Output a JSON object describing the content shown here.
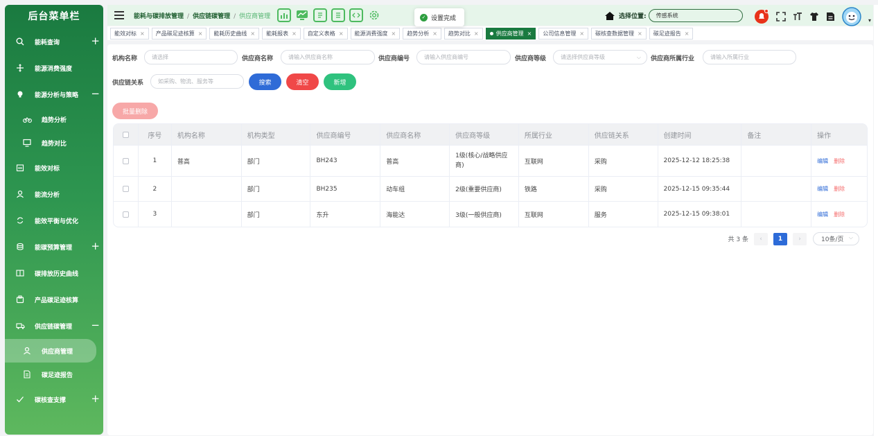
{
  "sidebar": {
    "title": "后台菜单栏",
    "items": [
      {
        "label": "能耗查询",
        "icon": "search-icon",
        "expander": "+"
      },
      {
        "label": "能源消费强度",
        "icon": "move-icon",
        "expander": ""
      },
      {
        "label": "能源分析与策略",
        "icon": "bulb-icon",
        "expander": "−"
      },
      {
        "label": "趋势分析",
        "icon": "bicycle-icon",
        "sub": true
      },
      {
        "label": "趋势对比",
        "icon": "monitor-icon",
        "sub": true
      },
      {
        "label": "能效对标",
        "icon": "calendar-icon",
        "expander": ""
      },
      {
        "label": "能流分析",
        "icon": "user-icon",
        "expander": ""
      },
      {
        "label": "能效平衡与优化",
        "icon": "refresh-icon",
        "expander": ""
      },
      {
        "label": "能碳预算管理",
        "icon": "coins-icon",
        "expander": "+"
      },
      {
        "label": "碳排放历史曲线",
        "icon": "book-icon",
        "expander": ""
      },
      {
        "label": "产品碳足迹核算",
        "icon": "box-icon",
        "expander": ""
      },
      {
        "label": "供应链碳管理",
        "icon": "truck-icon",
        "expander": "−"
      },
      {
        "label": "供应商管理",
        "icon": "user-icon",
        "sub": true,
        "active": true
      },
      {
        "label": "碳足迹报告",
        "icon": "document-icon",
        "sub": true
      },
      {
        "label": "碳核查支撑",
        "icon": "check-icon",
        "expander": "+"
      }
    ]
  },
  "breadcrumb": {
    "level1": "能耗与碳排放管理",
    "sep": "/",
    "level2": "供应链碳管理",
    "level3": "供应商管理"
  },
  "toast": {
    "icon": "check-icon",
    "text": "设置完成"
  },
  "location": {
    "label": "选择位置:",
    "value": "传感系统"
  },
  "tabs": [
    {
      "label": "能效对标",
      "close": "×"
    },
    {
      "label": "产品碳足迹核算",
      "close": "×"
    },
    {
      "label": "能耗历史曲线",
      "close": "×"
    },
    {
      "label": "能耗报表",
      "close": "×"
    },
    {
      "label": "自定义表格",
      "close": "×"
    },
    {
      "label": "能源消费强度",
      "close": "×"
    },
    {
      "label": "趋势分析",
      "close": "×"
    },
    {
      "label": "趋势对比",
      "close": "×"
    },
    {
      "label": "供应商管理",
      "close": "×",
      "active": true
    },
    {
      "label": "公司信息管理",
      "close": "×"
    },
    {
      "label": "碳核查数据管理",
      "close": "×"
    },
    {
      "label": "碳足迹报告",
      "close": "×"
    }
  ],
  "filters": {
    "org_name": {
      "label": "机构名称",
      "placeholder": "请选择"
    },
    "supplier_name": {
      "label": "供应商名称",
      "placeholder": "请输入供应商名称"
    },
    "supplier_code": {
      "label": "供应商编号",
      "placeholder": "请输入供应商编号"
    },
    "supplier_level": {
      "label": "供应商等级",
      "placeholder": "请选择供应商等级"
    },
    "industry": {
      "label": "供应商所属行业",
      "placeholder": "请输入所属行业"
    },
    "chain_relation": {
      "label": "供应链关系",
      "placeholder": "如采购、物流、服务等"
    }
  },
  "buttons": {
    "search": "搜索",
    "clear": "清空",
    "add": "新增",
    "batch_delete": "批量删除"
  },
  "colors": {
    "primary_green": "#1a7a40",
    "search_blue": "#2f6bd7",
    "clear_red": "#f04848",
    "add_green": "#2fc27e",
    "batch_pink": "#f7a8a8"
  },
  "table": {
    "headers": [
      "序号",
      "机构名称",
      "机构类型",
      "供应商编号",
      "供应商名称",
      "供应商等级",
      "所属行业",
      "供应链关系",
      "创建时间",
      "备注",
      "操作"
    ],
    "rows": [
      {
        "no": "1",
        "org": "普高",
        "type": "部门",
        "code": "BH243",
        "name": "普高",
        "level": "1级(核心/战略供应商)",
        "industry": "互联网",
        "relation": "采购",
        "created": "2025-12-12 18:25:38",
        "remark": "",
        "edit": "编辑",
        "delete": "删除"
      },
      {
        "no": "2",
        "org": "",
        "type": "部门",
        "code": "BH235",
        "name": "动车组",
        "level": "2级(重要供应商)",
        "industry": "铁路",
        "relation": "采购",
        "created": "2025-12-15 09:35:44",
        "remark": "",
        "edit": "编辑",
        "delete": "删除"
      },
      {
        "no": "3",
        "org": "",
        "type": "部门",
        "code": "东升",
        "name": "海能达",
        "level": "3级(一般供应商)",
        "industry": "互联网",
        "relation": "服务",
        "created": "2025-12-15 09:38:01",
        "remark": "",
        "edit": "编辑",
        "delete": "删除"
      }
    ]
  },
  "pagination": {
    "total": "共 3 条",
    "prev": "‹",
    "current": "1",
    "next": "›",
    "page_size": "10条/页"
  }
}
